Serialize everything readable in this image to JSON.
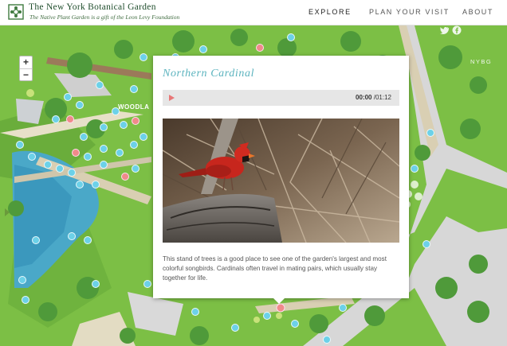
{
  "header": {
    "title": "The New York Botanical Garden",
    "subtitle": "The Native Plant Garden is a gift of the Leon Levy Foundation",
    "nav": [
      {
        "label": "EXPLORE",
        "active": true
      },
      {
        "label": "PLAN YOUR VISIT",
        "active": false
      },
      {
        "label": "ABOUT",
        "active": false
      }
    ]
  },
  "map": {
    "zoom_in": "+",
    "zoom_out": "−",
    "brand_tag": "NYBG",
    "area_label": "WOODLA",
    "social_icons": [
      "twitter-icon",
      "facebook-icon"
    ],
    "colors": {
      "grass": "#7cbf45",
      "water": "#4aa8c8",
      "path": "#d9cfb3",
      "tree": "#4f9a3a",
      "marker": "#6cd1e8",
      "marker_active": "#f08a8a"
    }
  },
  "popup": {
    "title": "Northern Cardinal",
    "audio": {
      "current": "00:00",
      "total": "/01:12"
    },
    "photo_alt": "Northern Cardinal",
    "description": "This stand of trees is a good place to see one of the garden's largest and most colorful songbirds. Cardinals often travel in mating pairs, which usually stay together for life."
  }
}
